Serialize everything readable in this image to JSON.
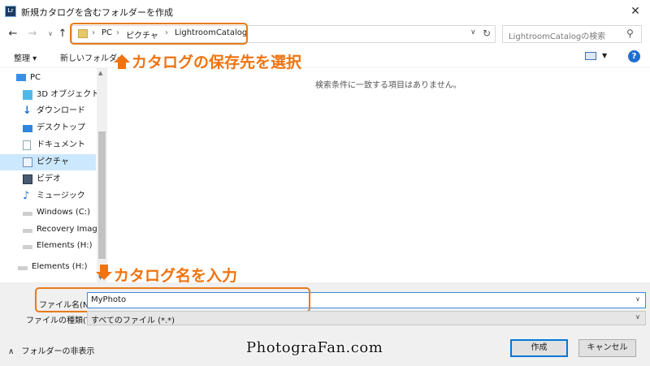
{
  "window": {
    "app_icon_text": "Lr",
    "title": "新規カタログを含むフォルダーを作成",
    "close_glyph": "✕"
  },
  "nav": {
    "back_glyph": "←",
    "forward_glyph": "→",
    "up_glyph": "↑",
    "breadcrumb": [
      "PC",
      "ピクチャ",
      "LightroomCatalog"
    ],
    "separator": "›",
    "search_placeholder": "LightroomCatalogの検索"
  },
  "toolbar": {
    "organize_label": "整理 ▾",
    "new_folder_label": "新しいフォルダー",
    "help_glyph": "?"
  },
  "sidebar": {
    "items": [
      {
        "label": "PC",
        "icon": "pc-icon"
      },
      {
        "label": "3D オブジェクト",
        "icon": "cube-icon"
      },
      {
        "label": "ダウンロード",
        "icon": "download-icon"
      },
      {
        "label": "デスクトップ",
        "icon": "desktop-icon"
      },
      {
        "label": "ドキュメント",
        "icon": "document-icon"
      },
      {
        "label": "ピクチャ",
        "icon": "pictures-icon",
        "selected": true
      },
      {
        "label": "ビデオ",
        "icon": "video-icon"
      },
      {
        "label": "ミュージック",
        "icon": "music-icon"
      },
      {
        "label": "Windows (C:)",
        "icon": "drive-icon"
      },
      {
        "label": "Recovery Image",
        "icon": "drive-icon"
      },
      {
        "label": "Elements (H:)",
        "icon": "drive-icon"
      },
      {
        "label": "Elements (H:)",
        "icon": "drive-icon"
      }
    ]
  },
  "main": {
    "empty_message": "検索条件に一致する項目はありません。"
  },
  "form": {
    "filename_label": "ファイル名(N):",
    "filename_value": "MyPhoto",
    "filetype_label": "ファイルの種類(T):",
    "filetype_value": "すべてのファイル (*.*)",
    "dropdown_glyph": "∨"
  },
  "footer": {
    "hide_folders_label": "フォルダーの非表示",
    "hide_glyph": "∧",
    "create_label": "作成",
    "cancel_label": "キャンセル",
    "watermark": "PhotograFan.com"
  },
  "annotations": {
    "location_callout": "カタログの保存先を選択",
    "name_callout": "カタログ名を入力",
    "accent_color": "#f0730f"
  }
}
